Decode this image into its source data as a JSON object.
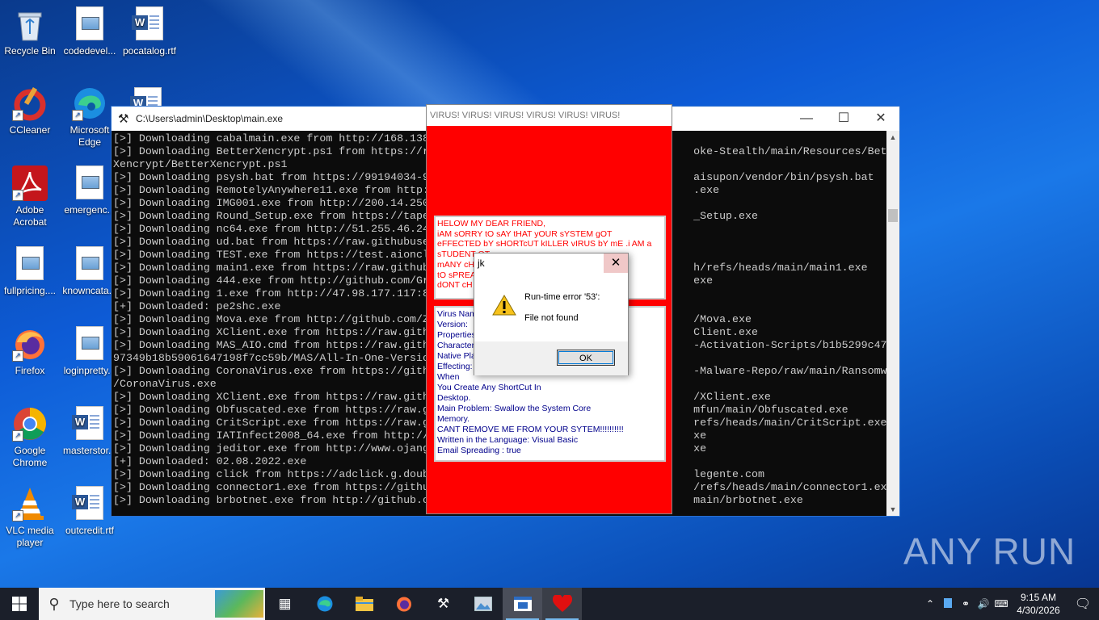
{
  "desktop": {
    "icons": [
      {
        "label": "Recycle Bin",
        "icon": "recycle-bin-icon"
      },
      {
        "label": "codedevel...",
        "icon": "image-file-icon"
      },
      {
        "label": "pocatalog.rtf",
        "icon": "word-document-icon"
      },
      {
        "label": "CCleaner",
        "icon": "ccleaner-icon"
      },
      {
        "label": "Microsoft Edge",
        "icon": "edge-icon"
      },
      {
        "label": "Adobe Acrobat",
        "icon": "acrobat-icon"
      },
      {
        "label": "emergenc...",
        "icon": "image-file-icon"
      },
      {
        "label": "fullpricing....",
        "icon": "image-file-icon"
      },
      {
        "label": "knowncata...",
        "icon": "image-file-icon"
      },
      {
        "label": "Firefox",
        "icon": "firefox-icon"
      },
      {
        "label": "loginpretty...",
        "icon": "image-file-icon"
      },
      {
        "label": "Google Chrome",
        "icon": "chrome-icon"
      },
      {
        "label": "masterstor...",
        "icon": "word-document-icon"
      },
      {
        "label": "VLC media player",
        "icon": "vlc-icon"
      },
      {
        "label": "outcredit.rtf",
        "icon": "word-document-icon"
      }
    ]
  },
  "console": {
    "title": "C:\\Users\\admin\\Desktop\\main.exe",
    "lines": [
      "[>] Downloading cabalmain.exe from http://168.138",
      "[>] Downloading BetterXencrypt.ps1 from https://r                                         oke-Stealth/main/Resources/Better",
      "Xencrypt/BetterXencrypt.ps1",
      "[>] Downloading psysh.bat from https://99194034-9                                         aisupon/vendor/bin/psysh.bat",
      "[>] Downloading RemotelyAnywhere11.exe from http:                                         .exe",
      "[>] Downloading IMG001.exe from http://200.14.250",
      "[>] Downloading Round_Setup.exe from https://tape                                         _Setup.exe",
      "[>] Downloading nc64.exe from http://51.255.46.24",
      "[>] Downloading ud.bat from https://raw.githubuse",
      "[>] Downloading TEST.exe from https://test.aioncl",
      "[>] Downloading main1.exe from https://raw.github                                         h/refs/heads/main/main1.exe",
      "[>] Downloading 444.exe from http://github.com/Gr                                         exe",
      "[>] Downloading 1.exe from http://47.98.177.117:8",
      "[+] Downloaded: pe2shc.exe",
      "[>] Downloading Mova.exe from http://github.com/Z                                         /Mova.exe",
      "[>] Downloading XClient.exe from https://raw.gith                                         Client.exe",
      "[>] Downloading MAS_AIO.cmd from https://raw.gith                                         -Activation-Scripts/b1b5299c4725d",
      "97349b18b59061647198f7cc59b/MAS/All-In-One-Versio",
      "[>] Downloading CoronaVirus.exe from https://gith                                         -Malware-Repo/raw/main/Ransomware",
      "/CoronaVirus.exe",
      "[>] Downloading XClient.exe from https://raw.gith                                         /XClient.exe",
      "[>] Downloading Obfuscated.exe from https://raw.g                                         mfun/main/Obfuscated.exe",
      "[>] Downloading CritScript.exe from https://raw.g                                         refs/heads/main/CritScript.exe",
      "[>] Downloading IATInfect2008_64.exe from http://                                         xe",
      "[>] Downloading jeditor.exe from http://www.ojang                                         xe",
      "[+] Downloaded: 02.08.2022.exe",
      "[>] Downloading click from https://adclick.g.doub                                         legente.com",
      "[>] Downloading connector1.exe from https://githu                                         /refs/heads/main/connector1.exe",
      "[>] Downloading brbotnet.exe from http://github.c                                         main/brbotnet.exe"
    ]
  },
  "virus_window": {
    "title": "VIRUS! VIRUS! VIRUS! VIRUS! VIRUS! VIRUS!",
    "message_lines": [
      "HELOW MY DEAR FRIEND,",
      "iAM sORRY tO sAY tHAT yOUR sYSTEM gOT",
      "eFFECTED bY sHORTcUT kILLER vIRUS bY mE .i AM a",
      "sTUDENT                                              OT",
      "mANY cH                                           WANT",
      "tO sPREA                                           HT",
      "dONT cH"
    ],
    "info_lines": [
      "Virus Nam",
      "Version:",
      "Properties",
      "Character",
      "Native Pla",
      "Effecting:                                                        d:",
      "When",
      "You Create Any ShortCut In",
      "Desktop.",
      "Main Problem:  Swallow the System Core",
      "Memory.",
      "CANT REMOVE ME FROM YOUR SYTEM!!!!!!!!!!",
      "Written in  the Language:  Visual Basic",
      "Email Spreading : true"
    ]
  },
  "dialog": {
    "title": "jk",
    "line1": "Run-time error '53':",
    "line2": "File not found",
    "ok_label": "OK"
  },
  "watermark": "ANY RUN",
  "taskbar": {
    "search_placeholder": "Type here to search",
    "time": "9:15 AM",
    "date": "4/30/2026"
  }
}
